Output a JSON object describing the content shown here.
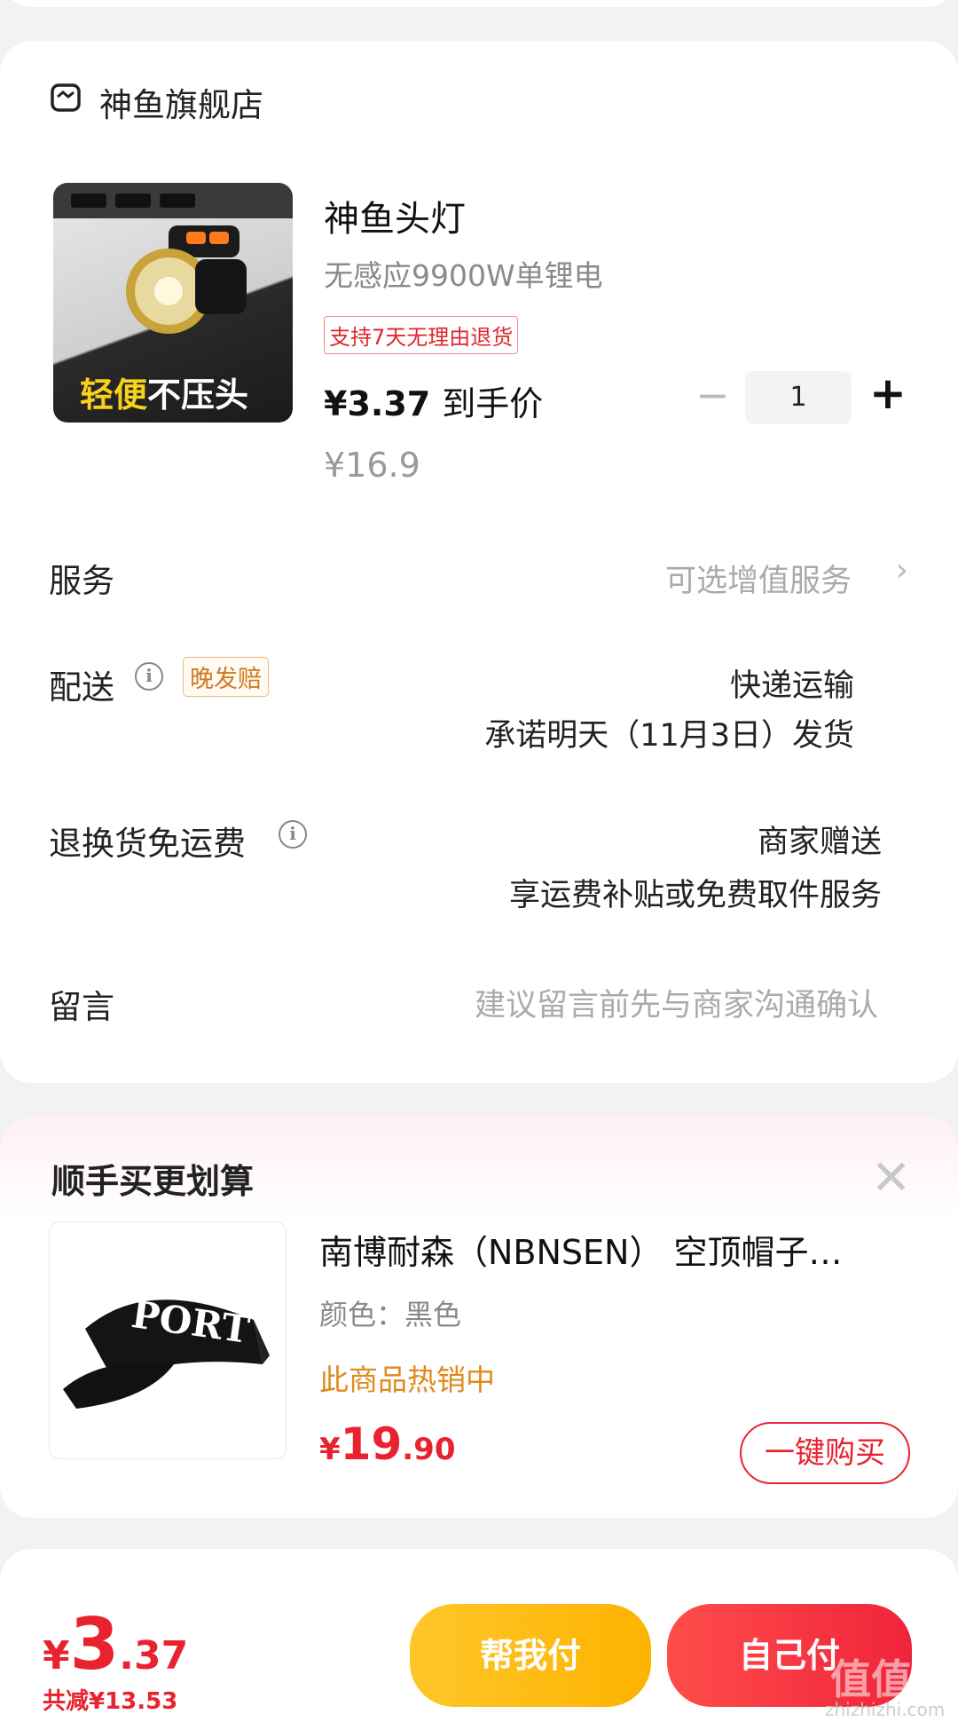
{
  "store": {
    "name": "神鱼旗舰店"
  },
  "product": {
    "image_text_a": "轻便",
    "image_text_b": "不压头",
    "title": "神鱼头灯",
    "spec": "无感应9900W单锂电",
    "return_tag": "支持7天无理由退货",
    "price": "¥3.37",
    "price_label": "到手价",
    "original_price": "¥16.9",
    "quantity": "1",
    "minus": "−",
    "plus": "+"
  },
  "rows": {
    "service": {
      "label": "服务",
      "value": "可选增值服务"
    },
    "delivery": {
      "label": "配送",
      "tag": "晚发赔",
      "method": "快递运输",
      "promise": "承诺明天（11月3日）发货"
    },
    "return_ship": {
      "label": "退换货免运费",
      "value": "商家赠送",
      "detail": "享运费补贴或免费取件服务"
    },
    "message": {
      "label": "留言",
      "placeholder": "建议留言前先与商家沟通确认"
    }
  },
  "upsell": {
    "title": "顺手买更划算",
    "close": "✕",
    "cap_text": "PORT",
    "name": "南博耐森（NBNSEN） 空顶帽子…",
    "color": "颜色：黑色",
    "hot": "此商品热销中",
    "price_symbol": "¥",
    "price_int": "19",
    "price_dec": ".90",
    "buy_label": "一键购买"
  },
  "footer": {
    "price_symbol": "¥",
    "price_int": "3",
    "price_dec": ".37",
    "saving": "共减¥13.53",
    "help_pay": "帮我付",
    "self_pay": "自己付",
    "watermark": "值值值",
    "watermark_sub": "zhizhizhi.com"
  },
  "colors": {
    "accent_red": "#e8232f",
    "help_yellow": "#fdb300",
    "hot_orange": "#e08a1c"
  }
}
